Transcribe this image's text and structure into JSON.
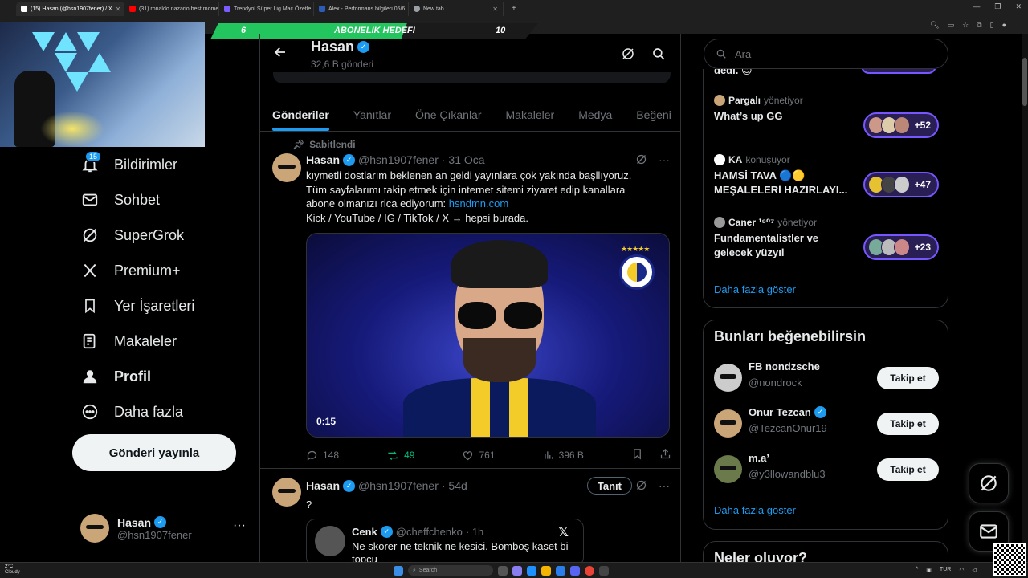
{
  "browser": {
    "tabs": [
      {
        "label": "(15) Hasan (@hsn1907fener) / X",
        "color": "#ffffff",
        "active": true
      },
      {
        "label": "(31) ronaldo nazario best mome",
        "color": "#ff0000",
        "active": false
      },
      {
        "label": "Trendyol Süper Lig Maç Özetle",
        "color": "#7b5cff",
        "active": false
      },
      {
        "label": "Alex - Performans bilgileri 05/6",
        "color": "#2b5db8",
        "active": false
      },
      {
        "label": "New tab",
        "color": "#9aa0a6",
        "active": false
      }
    ],
    "new_tab": "+"
  },
  "overlay": {
    "goal_left": "6",
    "goal_label": "ABONELIK HEDEFI",
    "goal_right": "10",
    "goal_progress": 0.6,
    "goal_color": "#22c55e"
  },
  "nav": {
    "notification_count": "15",
    "items": [
      {
        "label": "Bildirimler",
        "icon": "bell-icon"
      },
      {
        "label": "Sohbet",
        "icon": "mail-icon"
      },
      {
        "label": "SuperGrok",
        "icon": "grok-icon"
      },
      {
        "label": "Premium+",
        "icon": "x-logo-icon"
      },
      {
        "label": "Yer İşaretleri",
        "icon": "bookmark-icon"
      },
      {
        "label": "Makaleler",
        "icon": "article-icon"
      },
      {
        "label": "Profil",
        "icon": "person-icon"
      },
      {
        "label": "Daha fazla",
        "icon": "more-circle-icon"
      }
    ],
    "post_button": "Gönderi yayınla"
  },
  "account": {
    "name": "Hasan",
    "handle": "@hsn1907fener",
    "more": "···"
  },
  "profile": {
    "name": "Hasan",
    "posts_count": "32,6 B gönderi",
    "tabs": [
      "Gönderiler",
      "Yanıtlar",
      "Öne Çıkanlar",
      "Makaleler",
      "Medya",
      "Beğeni"
    ]
  },
  "tweet1": {
    "pinned_label": "Sabitlendi",
    "name": "Hasan",
    "handle": "@hsn1907fener",
    "date": "· 31 Oca",
    "text_line1": "kıymetli dostlarım beklenen an geldi yayınlara çok yakında başllıyoruz.",
    "text_line2": "Tüm sayfalarımı takip etmek için internet sitemi ziyaret edip kanallara",
    "text_line3_prefix": "abone olmanızı rica ediyorum: ",
    "link": "hsndmn.com",
    "text_line4": "Kick / YouTube / IG / TikTok / X → hepsi burada.",
    "video_duration": "0:15",
    "replies": "148",
    "reposts": "49",
    "likes": "761",
    "views": "396 B",
    "accent_color": "#00ba7c"
  },
  "tweet2": {
    "name": "Hasan",
    "handle": "@hsn1907fener",
    "date": "· 54d",
    "follow_label": "Tanıt",
    "text": "?",
    "quote": {
      "name": "Cenk",
      "handle": "@cheffchenko",
      "date": "· 1h",
      "text": "Ne skorer ne teknik ne kesici. Bomboş kaset bi topcu"
    }
  },
  "right": {
    "search_placeholder": "Ara",
    "spaces_top_text": "dedi.",
    "spaces": [
      {
        "host": "Pargalı",
        "role": "yönetiyor",
        "title": "What’s up GG",
        "count": "+52"
      },
      {
        "host": "KA",
        "role": "konuşuyor",
        "title": "HAMSİ TAVA 🔵🟡 MEŞALELERİ HAZIRLAYI...",
        "count": "+47"
      },
      {
        "host": "Caner ¹⁹⁰⁷",
        "role": "yönetiyor",
        "title": "Fundamentalistler ve gelecek yüzyıl",
        "count": "+23"
      }
    ],
    "show_more": "Daha fazla göster",
    "who_to_follow_title": "Bunları beğenebilirsin",
    "suggestions": [
      {
        "name": "FB nondzsche",
        "handle": "@nondrock",
        "verified": false,
        "button": "Takip et"
      },
      {
        "name": "Onur Tezcan",
        "handle": "@TezcanOnur19",
        "verified": true,
        "button": "Takip et"
      },
      {
        "name": "m.a’",
        "handle": "@y3llowandblu3",
        "verified": false,
        "button": "Takip et"
      }
    ],
    "show_more_2": "Daha fazla göster",
    "whats_happening": "Neler oluyor?"
  },
  "taskbar": {
    "temp": "2°C",
    "weather": "Cloudy",
    "search": "Search",
    "lang": "TUR"
  },
  "colors": {
    "accent": "#1d9bf0",
    "background": "#000000",
    "space_purple": "#7856ff"
  }
}
